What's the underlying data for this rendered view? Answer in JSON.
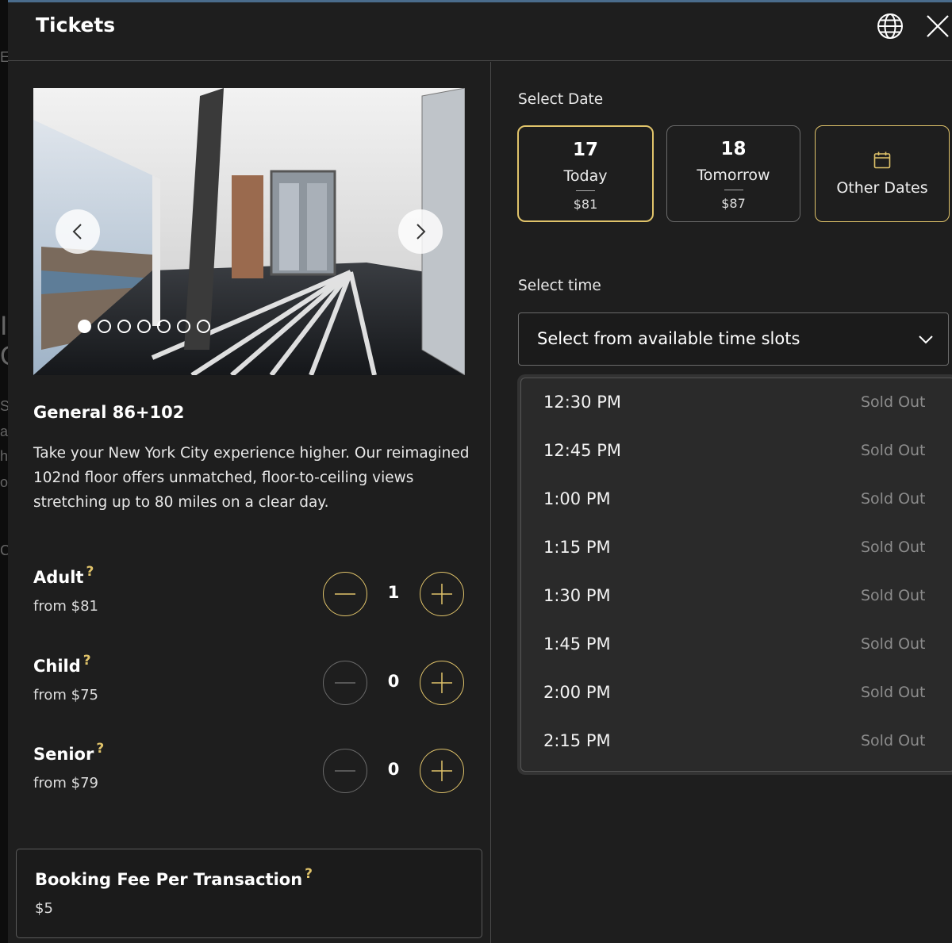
{
  "header": {
    "title": "Tickets"
  },
  "background": {
    "fragments": [
      "E",
      "I",
      "C",
      "S",
      "a",
      "h",
      "of",
      "C"
    ]
  },
  "carousel": {
    "slide_count": 7,
    "active_index": 0
  },
  "product": {
    "title": "General 86+102",
    "description": "Take your New York City experience higher. Our reimagined 102nd floor offers unmatched, floor-to-ceiling views stretching up to 80 miles on a clear day."
  },
  "tickets": [
    {
      "name": "Adult",
      "help": "?",
      "price": "from $81",
      "qty": "1"
    },
    {
      "name": "Child",
      "help": "?",
      "price": "from $75",
      "qty": "0"
    },
    {
      "name": "Senior",
      "help": "?",
      "price": "from $79",
      "qty": "0"
    }
  ],
  "fee": {
    "title": "Booking Fee Per Transaction",
    "help": "?",
    "value": "$5"
  },
  "date_section": {
    "label": "Select Date",
    "cards": [
      {
        "num": "17",
        "day": "Today",
        "price": "$81"
      },
      {
        "num": "18",
        "day": "Tomorrow",
        "price": "$87"
      }
    ],
    "other_label": "Other Dates"
  },
  "time_section": {
    "label": "Select time",
    "placeholder": "Select from available time slots",
    "slots": [
      {
        "time": "12:30 PM",
        "status": "Sold Out"
      },
      {
        "time": "12:45 PM",
        "status": "Sold Out"
      },
      {
        "time": "1:00 PM",
        "status": "Sold Out"
      },
      {
        "time": "1:15 PM",
        "status": "Sold Out"
      },
      {
        "time": "1:30 PM",
        "status": "Sold Out"
      },
      {
        "time": "1:45 PM",
        "status": "Sold Out"
      },
      {
        "time": "2:00 PM",
        "status": "Sold Out"
      },
      {
        "time": "2:15 PM",
        "status": "Sold Out"
      }
    ]
  },
  "colors": {
    "accent": "#e0c36a",
    "background": "#1e1e1e",
    "muted": "#8c8c8c"
  },
  "icons": [
    "globe-icon",
    "close-icon",
    "chevron-left-icon",
    "chevron-right-icon",
    "minus-icon",
    "plus-icon",
    "calendar-icon",
    "chevron-down-icon"
  ]
}
